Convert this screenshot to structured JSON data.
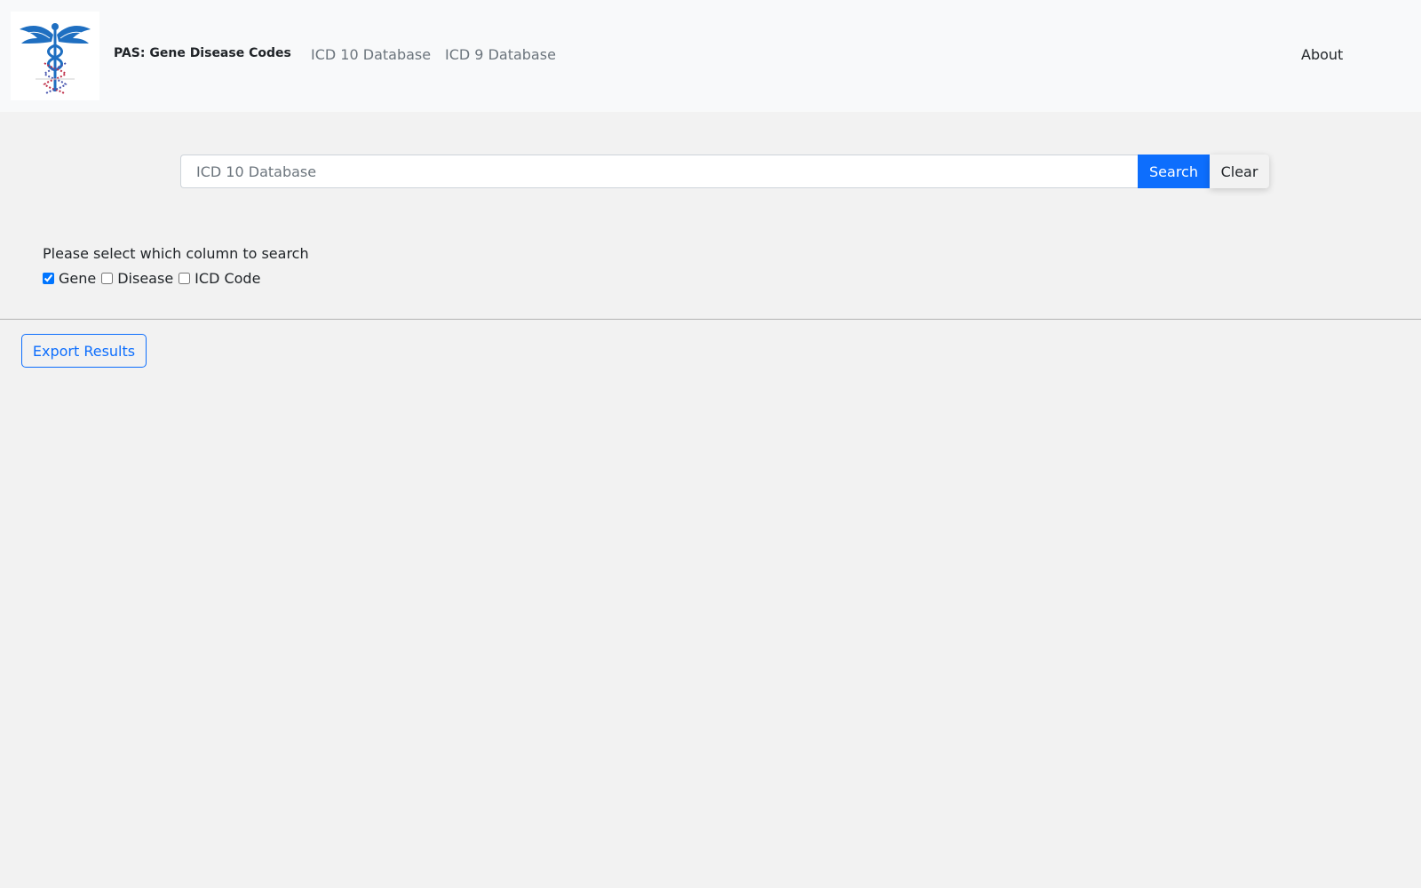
{
  "navbar": {
    "brand": "PAS: Gene Disease Codes",
    "links": [
      {
        "label": "ICD 10 Database"
      },
      {
        "label": "ICD 9 Database"
      }
    ],
    "about": "About",
    "logo_icon": "caduceus-dna-icon"
  },
  "search": {
    "placeholder": "ICD 10 Database",
    "value": "",
    "search_label": "Search",
    "clear_label": "Clear"
  },
  "columns": {
    "prompt": "Please select which column to search",
    "options": [
      {
        "label": "Gene",
        "checked": true
      },
      {
        "label": "Disease",
        "checked": false
      },
      {
        "label": "ICD Code",
        "checked": false
      }
    ]
  },
  "export_label": "Export Results",
  "colors": {
    "primary": "#0d6efd",
    "navbar_bg": "#f8f9fa",
    "page_bg": "#f2f2f2",
    "logo_blue": "#1f6fc1",
    "logo_red": "#c0304a"
  }
}
